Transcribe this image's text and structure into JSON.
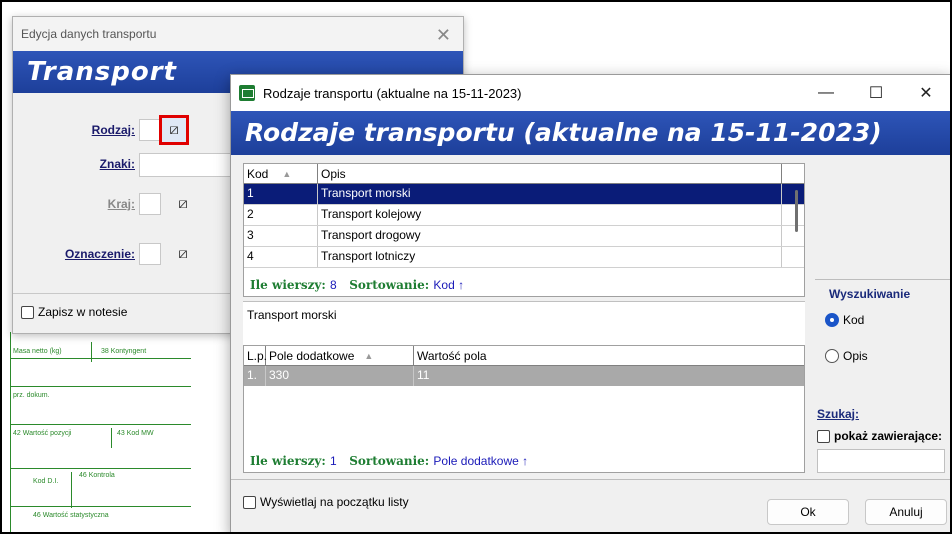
{
  "back_dialog": {
    "title": "Edycja danych transportu",
    "banner": "Transport",
    "fields": {
      "rodzaj_label": "Rodzaj:",
      "znaki_label": "Znaki:",
      "kraj_label": "Kraj:",
      "oznaczenie_label": "Oznaczenie:"
    },
    "zapisz_label": "Zapisz w notesie"
  },
  "background_form": {
    "cell1": "Masa netto (kg)",
    "cell2": "38 Kontyngent",
    "cell3": "prz. dokum.",
    "cell4": "42 Wartość pozycji",
    "cell5": "43 Kod MW",
    "cell6": "Kod D.I.",
    "cell7": "46 Kontrola",
    "cell8": "46 Wartość statystyczna"
  },
  "front_dialog": {
    "title": "Rodzaje transportu  (aktualne na 15-11-2023)",
    "banner": "Rodzaje transportu  (aktualne na 15-11-2023)",
    "window_buttons": {
      "minimize": "—",
      "maximize": "☐",
      "close": "✕"
    },
    "grid": {
      "headers": {
        "kod": "Kod",
        "opis": "Opis"
      },
      "rows": [
        {
          "kod": "1",
          "opis": "Transport morski"
        },
        {
          "kod": "2",
          "opis": "Transport kolejowy"
        },
        {
          "kod": "3",
          "opis": "Transport drogowy"
        },
        {
          "kod": "4",
          "opis": "Transport lotniczy"
        }
      ],
      "status_rows_label": "Ile wierszy:",
      "status_rows_value": "8",
      "status_sort_label": "Sortowanie:",
      "status_sort_value": "Kod ↑"
    },
    "description": "Transport morski",
    "grid2": {
      "headers": {
        "lp": "L.p.",
        "pole": "Pole dodatkowe",
        "wartosc": "Wartość pola"
      },
      "rows": [
        {
          "lp": "1.",
          "pole": "330",
          "wartosc": "11"
        }
      ],
      "status_rows_label": "Ile wierszy:",
      "status_rows_value": "1",
      "status_sort_label": "Sortowanie:",
      "status_sort_value": "Pole dodatkowe ↑"
    },
    "side": {
      "search_title": "Wyszukiwanie",
      "radio_kod": "Kod",
      "radio_opis": "Opis",
      "szukaj_label": "Szukaj:",
      "pokaz_label": "pokaż zawierające:"
    },
    "wyswietlaj_label": "Wyświetlaj na początku listy",
    "ok_label": "Ok",
    "anuluj_label": "Anuluj"
  }
}
